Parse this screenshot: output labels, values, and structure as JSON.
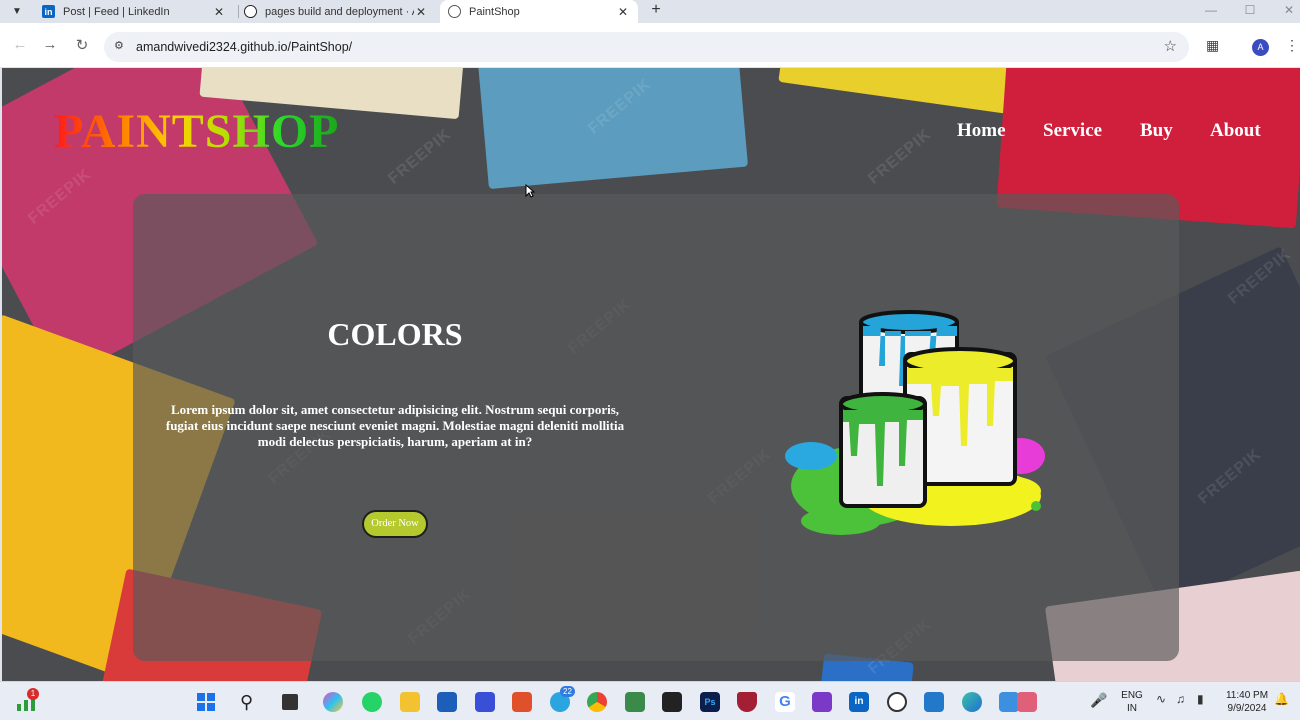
{
  "browser": {
    "tabs": [
      {
        "title": "Post | Feed | LinkedIn",
        "favicon": "linkedin-icon",
        "active": false
      },
      {
        "title": "pages build and deployment · A",
        "favicon": "github-icon",
        "active": false
      },
      {
        "title": "PaintShop",
        "favicon": "globe-icon",
        "active": true
      }
    ],
    "url": "amandwivedi2324.github.io/PaintShop/",
    "avatar_letter": "A"
  },
  "site": {
    "logo": "PAINTSHOP",
    "nav": [
      "Home",
      "Service",
      "Buy",
      "About"
    ],
    "hero": {
      "title": "COLORS",
      "text": "Lorem ipsum dolor sit, amet consectetur adipisicing elit. Nostrum sequi corporis, fugiat eius incidunt saepe nesciunt eveniet magni. Molestiae magni deleniti mollitia modi delectus perspiciatis, harum, aperiam at in?",
      "button": "Order Now",
      "button_color": "#b5c92f"
    },
    "watermark": "FREEPIK"
  },
  "taskbar": {
    "widget_badge": "1",
    "telegram_badge": "22",
    "language": "ENG",
    "region": "IN",
    "time": "11:40 PM",
    "date": "9/9/2024"
  }
}
